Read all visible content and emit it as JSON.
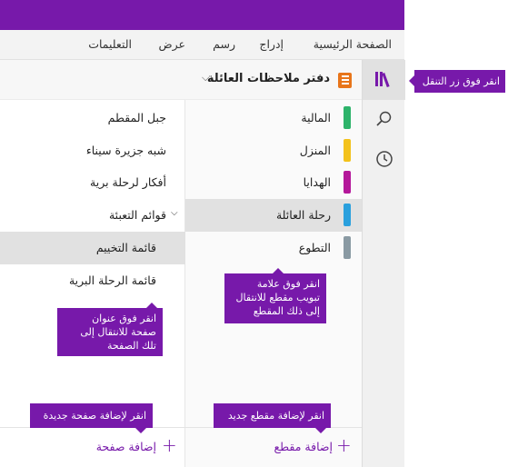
{
  "menu": {
    "home": "الصفحة الرئيسية",
    "insert": "إدراج",
    "draw": "رسم",
    "view": "عرض",
    "help": "التعليمات"
  },
  "icons": {
    "navigation": "notebooks-icon",
    "search": "search-icon",
    "recent": "clock-icon",
    "notebook": "notebook-icon"
  },
  "colors": {
    "brand": "#7719aa"
  },
  "notebook": {
    "name": "دفتر ملاحظات العائلة"
  },
  "sections": [
    {
      "label": "المالية",
      "color": "#2db36a"
    },
    {
      "label": "المنزل",
      "color": "#f3c21b"
    },
    {
      "label": "الهدايا",
      "color": "#b4179a"
    },
    {
      "label": "رحلة العائلة",
      "color": "#2aa0dd",
      "selected": true
    },
    {
      "label": "التطوع",
      "color": "#8a9aa3"
    }
  ],
  "pages": [
    {
      "label": "جبل المقطم"
    },
    {
      "label": "شبه جزيرة سيناء"
    },
    {
      "label": "أفكار لرحلة برية"
    },
    {
      "label": "قوائم التعبئة",
      "expandable": true
    },
    {
      "label": "قائمة التخييم",
      "selected": true
    },
    {
      "label": "قائمة الرحلة البرية"
    }
  ],
  "add_section": "إضافة مقطع",
  "add_page": "إضافة صفحة",
  "callouts": {
    "nav_button": "انقر فوق زر التنقل",
    "section_tab": "انقر فوق علامة تبويب مقطع للانتقال إلى ذلك المقطع",
    "page_title": "انقر فوق عنوان صفحة للانتقال إلى تلك الصفحة",
    "new_section": "انقر لإضافة مقطع جديد",
    "new_page": "انقر لإضافة صفحة جديدة"
  }
}
